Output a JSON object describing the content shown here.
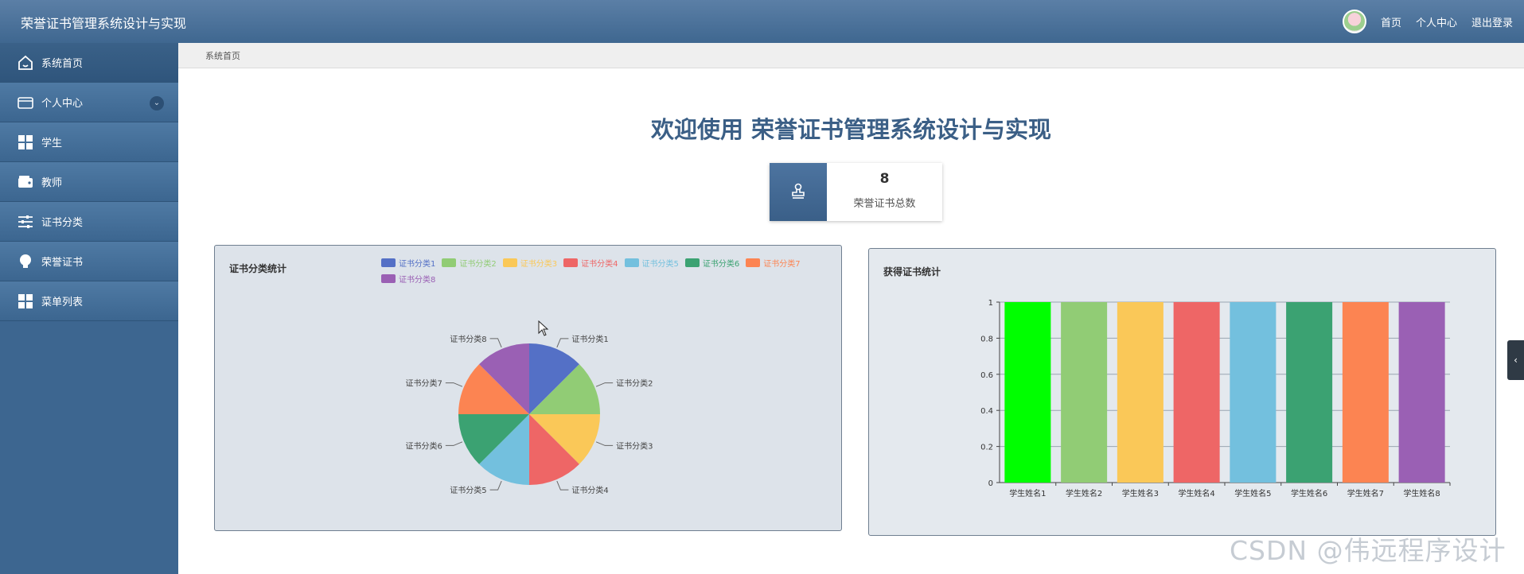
{
  "header": {
    "app_title": "荣誉证书管理系统设计与实现",
    "nav": [
      "首页",
      "个人中心",
      "退出登录"
    ]
  },
  "sidebar": {
    "items": [
      {
        "label": "系统首页",
        "icon": "home-icon"
      },
      {
        "label": "个人中心",
        "icon": "wallet-icon",
        "expandable": true
      },
      {
        "label": "学生",
        "icon": "grid-icon"
      },
      {
        "label": "教师",
        "icon": "wallet-icon"
      },
      {
        "label": "证书分类",
        "icon": "sliders-icon"
      },
      {
        "label": "荣誉证书",
        "icon": "bulb-icon"
      },
      {
        "label": "菜单列表",
        "icon": "grid-icon"
      }
    ]
  },
  "breadcrumb": "系统首页",
  "welcome": "欢迎使用 荣誉证书管理系统设计与实现",
  "stat": {
    "value": "8",
    "label": "荣誉证书总数",
    "icon": "stamp-icon"
  },
  "watermark": "CSDN @伟远程序设计",
  "colors": {
    "topbar": "#4a7099",
    "sidebar": "#3d6690",
    "title": "#3b5f86",
    "palette": [
      "#5470c6",
      "#91cc75",
      "#fac858",
      "#ee6666",
      "#73c0de",
      "#3ba272",
      "#fc8452",
      "#9a60b4"
    ]
  },
  "chart_data": [
    {
      "type": "pie",
      "title": "证书分类统计",
      "categories": [
        "证书分类1",
        "证书分类2",
        "证书分类3",
        "证书分类4",
        "证书分类5",
        "证书分类6",
        "证书分类7",
        "证书分类8"
      ],
      "values": [
        1,
        1,
        1,
        1,
        1,
        1,
        1,
        1
      ],
      "colors": [
        "#5470c6",
        "#91cc75",
        "#fac858",
        "#ee6666",
        "#73c0de",
        "#3ba272",
        "#fc8452",
        "#9a60b4"
      ],
      "legend": "top-right"
    },
    {
      "type": "bar",
      "title": "获得证书统计",
      "categories": [
        "学生姓名1",
        "学生姓名2",
        "学生姓名3",
        "学生姓名4",
        "学生姓名5",
        "学生姓名6",
        "学生姓名7",
        "学生姓名8"
      ],
      "values": [
        1,
        1,
        1,
        1,
        1,
        1,
        1,
        1
      ],
      "colors": [
        "#00ff00",
        "#91cc75",
        "#fac858",
        "#ee6666",
        "#73c0de",
        "#3ba272",
        "#fc8452",
        "#9a60b4"
      ],
      "ylim": [
        0,
        1
      ],
      "yticks": [
        "0",
        "0.2",
        "0.4",
        "0.6",
        "0.8",
        "1"
      ],
      "grid": true
    }
  ]
}
